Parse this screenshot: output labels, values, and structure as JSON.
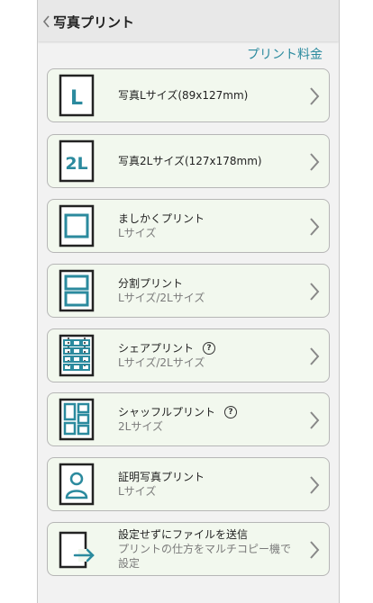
{
  "header": {
    "title": "写真プリント",
    "back_icon": "chevron-left-icon"
  },
  "price_link": "プリント料金",
  "colors": {
    "accent": "#2b8a9e",
    "card_bg": "#f2f8ee",
    "border": "#b6b6b6"
  },
  "items": [
    {
      "icon": "l-size-icon",
      "icon_text": "L",
      "main": "写真Lサイズ(89x127mm)",
      "sub": ""
    },
    {
      "icon": "2l-size-icon",
      "icon_text": "2L",
      "main": "写真2Lサイズ(127x178mm)",
      "sub": ""
    },
    {
      "icon": "square-print-icon",
      "main": "ましかくプリント",
      "sub": "Lサイズ"
    },
    {
      "icon": "split-print-icon",
      "main": "分割プリント",
      "sub": "Lサイズ/2Lサイズ"
    },
    {
      "icon": "share-print-icon",
      "main": "シェアプリント",
      "sub": "Lサイズ/2Lサイズ",
      "help": "?"
    },
    {
      "icon": "shuffle-print-icon",
      "main": "シャッフルプリント",
      "sub": "2Lサイズ",
      "help": "?"
    },
    {
      "icon": "id-photo-icon",
      "main": "証明写真プリント",
      "sub": "Lサイズ"
    },
    {
      "icon": "send-file-icon",
      "main": "設定せずにファイルを送信",
      "sub": "プリントの仕方をマルチコピー機で設定"
    }
  ]
}
